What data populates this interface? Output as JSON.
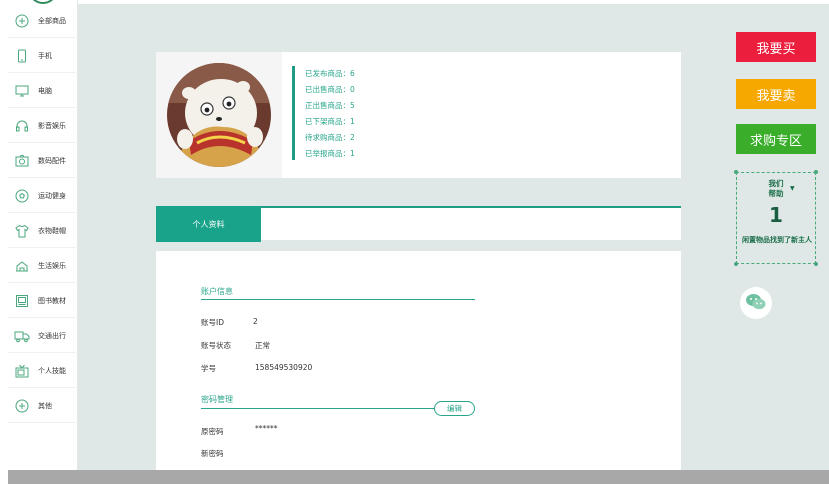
{
  "sidebar": {
    "items": [
      {
        "label": "全部商品",
        "icon": "plus-circle-icon"
      },
      {
        "label": "手机",
        "icon": "phone-icon"
      },
      {
        "label": "电脑",
        "icon": "monitor-icon"
      },
      {
        "label": "影音娱乐",
        "icon": "headphones-icon"
      },
      {
        "label": "数码配件",
        "icon": "camera-icon"
      },
      {
        "label": "运动健身",
        "icon": "soccer-ball-icon"
      },
      {
        "label": "衣物鞋帽",
        "icon": "shirt-icon"
      },
      {
        "label": "生活娱乐",
        "icon": "home-icon"
      },
      {
        "label": "图书教材",
        "icon": "book-icon"
      },
      {
        "label": "交通出行",
        "icon": "truck-icon"
      },
      {
        "label": "个人技能",
        "icon": "tv-icon"
      },
      {
        "label": "其他",
        "icon": "plus-circle-icon"
      }
    ]
  },
  "profile": {
    "stats": [
      "已发布商品：6",
      "已出售商品：0",
      "正出售商品：5",
      "已下架商品：1",
      "待求购商品：2",
      "已举报商品：1"
    ]
  },
  "tabs": {
    "active": "个人资料"
  },
  "account": {
    "section_title": "账户信息",
    "rows": [
      {
        "label": "账号ID",
        "value": "2"
      },
      {
        "label": "账号状态",
        "value": "正常"
      },
      {
        "label": "学号",
        "value": "158549530920"
      }
    ]
  },
  "password": {
    "section_title": "密码管理",
    "edit_label": "编辑",
    "rows": [
      {
        "label": "原密码",
        "value": "******"
      },
      {
        "label": "新密码",
        "value": ""
      }
    ]
  },
  "actions": {
    "buy": "我要买",
    "sell": "我要卖",
    "want": "求购专区"
  },
  "help": {
    "title_line1": "我们",
    "title_line2": "帮助",
    "count": "1",
    "sub": "闲置物品找到了新主人"
  },
  "colors": {
    "accent": "#1aa38b",
    "buy": "#eb1f3d",
    "sell": "#f7a800",
    "want": "#3aae2a"
  }
}
